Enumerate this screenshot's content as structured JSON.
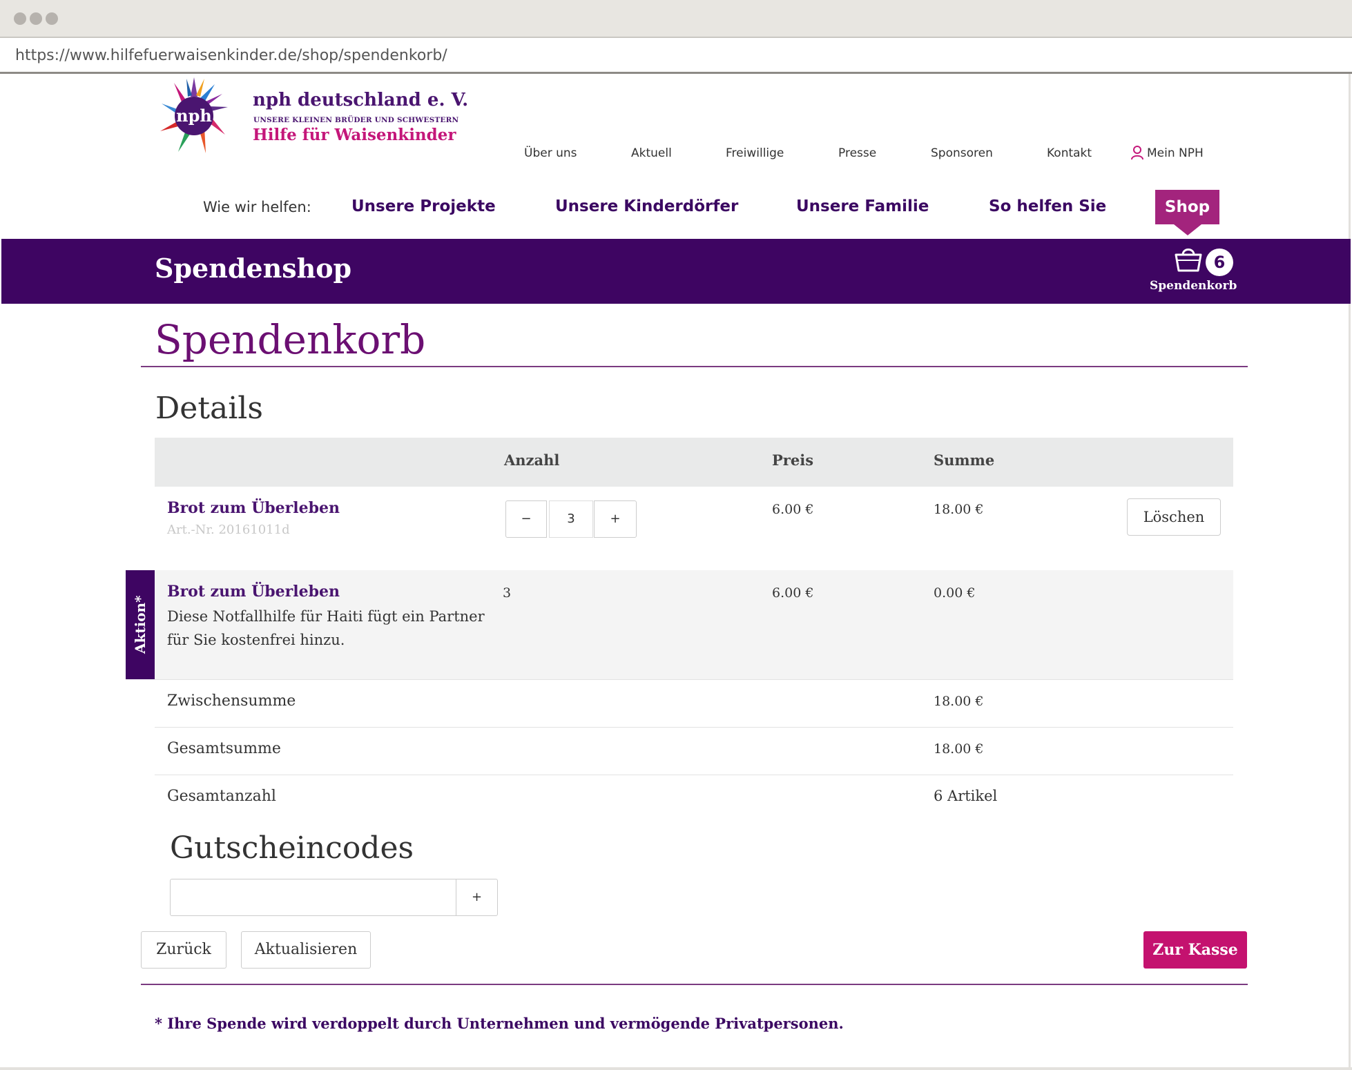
{
  "browser": {
    "url": "https://www.hilfefuerwaisenkinder.de/shop/spendenkorb/"
  },
  "logo": {
    "mark_text": "nph",
    "title": "nph deutschland e. V.",
    "subtitle": "UNSERE KLEINEN BRÜDER UND SCHWESTERN",
    "tagline": "Hilfe für Waisenkinder"
  },
  "top_nav": {
    "items": [
      "Über uns",
      "Aktuell",
      "Freiwillige",
      "Presse",
      "Sponsoren",
      "Kontakt",
      "Mein NPH"
    ],
    "user_icon": "user-icon"
  },
  "main_nav": {
    "lead": "Wie wir helfen:",
    "items": [
      "Unsere Projekte",
      "Unsere Kinderdörfer",
      "Unsere Familie",
      "So helfen Sie",
      "Shop"
    ],
    "active": "Shop"
  },
  "band": {
    "title": "Spendenshop",
    "cart_count": "6",
    "cart_label": "Spendenkorb",
    "cart_icon": "basket-icon"
  },
  "page": {
    "title": "Spendenkorb",
    "details_heading": "Details"
  },
  "table": {
    "headers": {
      "quantity": "Anzahl",
      "price": "Preis",
      "sum": "Summe"
    },
    "rows": [
      {
        "name": "Brot zum Überleben",
        "art_nr": "Art.-Nr. 20161011d",
        "qty_minus": "−",
        "qty": "3",
        "qty_plus": "+",
        "price": "6.00 €",
        "sum": "18.00 €",
        "delete_label": "Löschen"
      }
    ],
    "promo": {
      "tab_label": "Aktion*",
      "name": "Brot zum Überleben",
      "description": "Diese Notfallhilfe für Haiti fügt ein Partner für Sie kostenfrei hinzu.",
      "qty": "3",
      "price": "6.00 €",
      "sum": "0.00 €"
    },
    "totals": [
      {
        "label": "Zwischensumme",
        "value": "18.00 €"
      },
      {
        "label": "Gesamtsumme",
        "value": "18.00 €"
      },
      {
        "label": "Gesamtanzahl",
        "value": "6 Artikel"
      }
    ]
  },
  "voucher": {
    "heading": "Gutscheincodes",
    "value": "",
    "placeholder": "",
    "add_label": "+"
  },
  "buttons": {
    "back": "Zurück",
    "update": "Aktualisieren",
    "checkout": "Zur Kasse"
  },
  "footnote": "* Ihre Spende wird verdoppelt durch Unternehmen und vermögende Privatpersonen.",
  "colors": {
    "brand_purple": "#3e0562",
    "accent_magenta": "#c4126f",
    "shop_tab": "#a3247d"
  }
}
